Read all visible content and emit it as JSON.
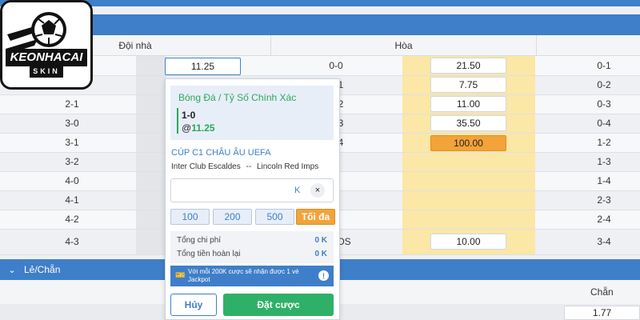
{
  "columns": {
    "home": "Đội nhà",
    "draw": "Hòa"
  },
  "rows": [
    {
      "home": "",
      "draw": "0-0",
      "away": "0-1",
      "draw_odd": "21.50"
    },
    {
      "home": "",
      "draw": "1",
      "away": "0-2",
      "draw_odd": "7.75"
    },
    {
      "home": "2-1",
      "draw": "2",
      "away": "0-3",
      "draw_odd": "11.00"
    },
    {
      "home": "3-0",
      "draw": "3",
      "away": "0-4",
      "draw_odd": "35.50"
    },
    {
      "home": "3-1",
      "draw": "4",
      "away": "1-2",
      "draw_odd": "100.00"
    },
    {
      "home": "3-2",
      "draw": "",
      "away": "1-3",
      "draw_odd": ""
    },
    {
      "home": "4-0",
      "draw": "",
      "away": "1-4",
      "draw_odd": ""
    },
    {
      "home": "4-1",
      "draw": "",
      "away": "2-3",
      "draw_odd": ""
    },
    {
      "home": "4-2",
      "draw": "",
      "away": "2-4",
      "draw_odd": ""
    },
    {
      "home": "4-3",
      "draw": "OS",
      "away": "3-4",
      "draw_odd": "10.00"
    }
  ],
  "selected_home_odd": "11.25",
  "logo": {
    "text": "KEONHACAI",
    "sub": "SKIN"
  },
  "slip": {
    "market": "Bóng Đá / Tỷ Số Chính Xác",
    "score": "1-0",
    "odd_prefix": "@",
    "odd": "11.25",
    "competition": "CÚP C1 CHÂU ÂU UEFA",
    "team_home": "Inter Club Escaldes",
    "team_sep": "--",
    "team_away": "Lincoln Red Imps",
    "stake_placeholder": "",
    "stake_unit": "K",
    "clear": "×",
    "chips": [
      "100",
      "200",
      "500"
    ],
    "max_label": "Tối đa",
    "total_cost_label": "Tổng chi phí",
    "total_cost_value": "0 K",
    "total_return_label": "Tổng tiền hoàn lại",
    "total_return_value": "0 K",
    "promo": "Với mỗi 200K cược sẽ nhận được 1 vé Jackpot",
    "cancel": "Hủy",
    "place": "Đặt cược"
  },
  "section2": {
    "title": "Lẻ/Chẵn",
    "col_even": "Chẵn",
    "even_odd": "1.77"
  },
  "colors": {
    "primary": "#3f7fc9",
    "green": "#2fb067",
    "orange": "#f2a33a",
    "yellow": "#fbe7a6"
  }
}
